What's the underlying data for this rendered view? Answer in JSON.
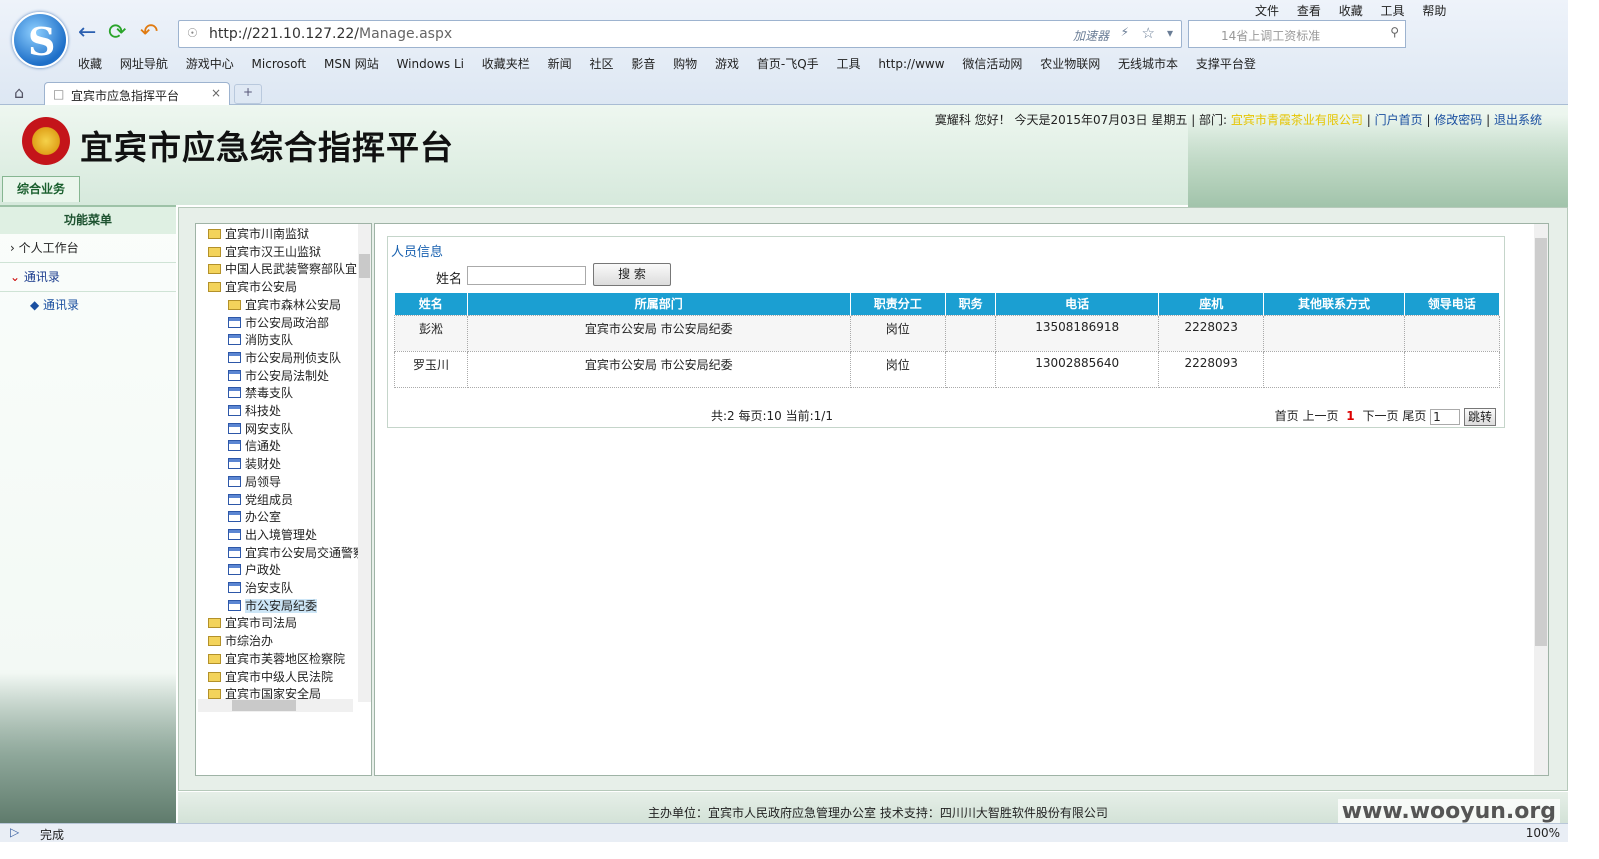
{
  "browser": {
    "url_prefix": "http://221.10.127.22/",
    "url_path": "Manage.aspx",
    "accelerator": "加速器",
    "search_placeholder": "14省上调工资标准",
    "menu": [
      "文件",
      "查看",
      "收藏",
      "工具",
      "帮助"
    ],
    "bookmarks": [
      "收藏",
      "网址导航",
      "游戏中心",
      "Microsoft",
      "MSN 网站",
      "Windows Li",
      "收藏夹栏",
      "新闻",
      "社区",
      "影音",
      "购物",
      "游戏",
      "首页-飞Q手",
      "工具",
      "http://www",
      "微信活动网",
      "农业物联网",
      "无线城市本",
      "支撑平台登"
    ],
    "tab_title": "宜宾市应急指挥平台",
    "status": "完成",
    "zoom": "100%"
  },
  "header": {
    "title": "宜宾市应急综合指挥平台",
    "user_greeting": "寞耀科 您好！",
    "date_text": "今天是2015年07月03日 星期五",
    "dept_label": "部门:",
    "dept_value": "宜宾市青霞茶业有限公司",
    "links": [
      "门户首页",
      "修改密码",
      "退出系统"
    ],
    "main_tab": "综合业务"
  },
  "leftnav": {
    "head": "功能菜单",
    "items": [
      "个人工作台",
      "通讯录"
    ],
    "sub": "通讯录"
  },
  "tree": {
    "nodes": [
      {
        "label": "宜宾市川南监狱",
        "type": "folder",
        "level": 0
      },
      {
        "label": "宜宾市汉王山监狱",
        "type": "folder",
        "level": 0
      },
      {
        "label": "中国人民武装警察部队宜",
        "type": "folder",
        "level": 0
      },
      {
        "label": "宜宾市公安局",
        "type": "folder",
        "level": 0
      },
      {
        "label": "宜宾市森林公安局",
        "type": "folder",
        "level": 1
      },
      {
        "label": "市公安局政治部",
        "type": "page",
        "level": 1
      },
      {
        "label": "消防支队",
        "type": "page",
        "level": 1
      },
      {
        "label": "市公安局刑侦支队",
        "type": "page",
        "level": 1
      },
      {
        "label": "市公安局法制处",
        "type": "page",
        "level": 1
      },
      {
        "label": "禁毒支队",
        "type": "page",
        "level": 1
      },
      {
        "label": "科技处",
        "type": "page",
        "level": 1
      },
      {
        "label": "网安支队",
        "type": "page",
        "level": 1
      },
      {
        "label": "信通处",
        "type": "page",
        "level": 1
      },
      {
        "label": "装财处",
        "type": "page",
        "level": 1
      },
      {
        "label": "局领导",
        "type": "page",
        "level": 1
      },
      {
        "label": "党组成员",
        "type": "page",
        "level": 1
      },
      {
        "label": "办公室",
        "type": "page",
        "level": 1
      },
      {
        "label": "出入境管理处",
        "type": "page",
        "level": 1
      },
      {
        "label": "宜宾市公安局交通警察",
        "type": "page",
        "level": 1
      },
      {
        "label": "户政处",
        "type": "page",
        "level": 1
      },
      {
        "label": "治安支队",
        "type": "page",
        "level": 1
      },
      {
        "label": "市公安局纪委",
        "type": "page",
        "level": 1,
        "selected": true
      },
      {
        "label": "宜宾市司法局",
        "type": "folder",
        "level": 0
      },
      {
        "label": "市综治办",
        "type": "folder",
        "level": 0
      },
      {
        "label": "宜宾市芙蓉地区检察院",
        "type": "folder",
        "level": 0
      },
      {
        "label": "宜宾市中级人民法院",
        "type": "folder",
        "level": 0
      },
      {
        "label": "宜宾市国家安全局",
        "type": "folder",
        "level": 0
      }
    ]
  },
  "panel": {
    "title": "人员信息",
    "name_label": "姓名",
    "search_button": "搜 索",
    "columns": [
      "姓名",
      "所属部门",
      "职责分工",
      "职务",
      "电话",
      "座机",
      "其他联系方式",
      "领导电话"
    ],
    "rows": [
      [
        "彭淞",
        "宜宾市公安局 市公安局纪委",
        "岗位",
        "",
        "13508186918",
        "2228023",
        "",
        ""
      ],
      [
        "罗玉川",
        "宜宾市公安局 市公安局纪委",
        "岗位",
        "",
        "13002885640",
        "2228093",
        "",
        ""
      ]
    ],
    "page_info": "共:2  每页:10  当前:1/1",
    "pager": {
      "first": "首页",
      "prev": "上一页",
      "current": "1",
      "next": "下一页",
      "last": "尾页",
      "page_input": "1",
      "jump": "跳转"
    }
  },
  "footer": "主办单位：宜宾市人民政府应急管理办公室  技术支持：四川川大智胜软件股份有限公司",
  "watermark": "www.wooyun.org"
}
